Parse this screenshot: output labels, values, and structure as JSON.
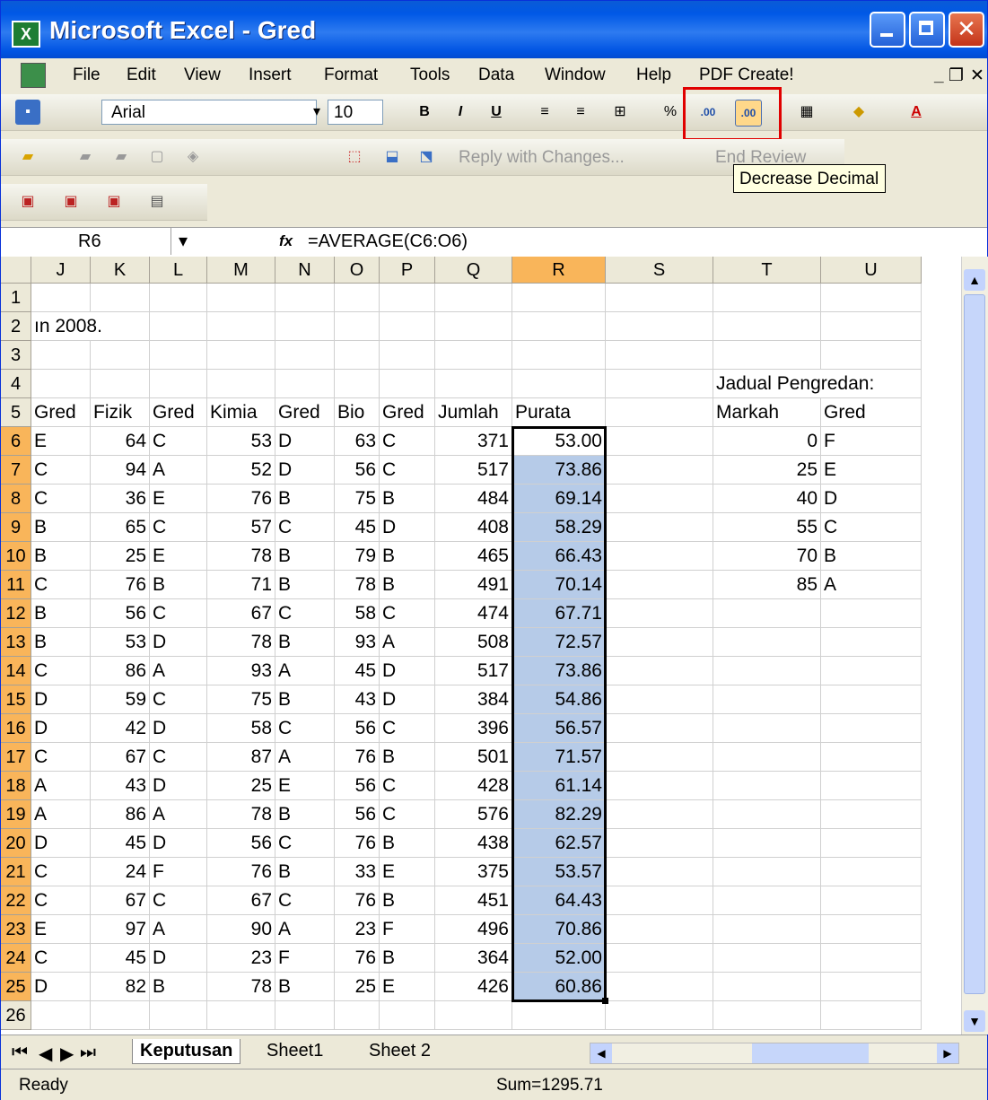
{
  "window": {
    "title": "Microsoft Excel - Gred",
    "icon": "excel-icon"
  },
  "menu": [
    "File",
    "Edit",
    "View",
    "Insert",
    "Format",
    "Tools",
    "Data",
    "Window",
    "Help",
    "PDF Create!"
  ],
  "format_toolbar": {
    "font": "Arial",
    "size": "10",
    "tooltip": "Decrease Decimal",
    "highlight_color": "#e00000"
  },
  "review_toolbar": {
    "reply": "Reply with Changes...",
    "end": "End Review"
  },
  "formula_bar": {
    "name_box": "R6",
    "fx": "fx",
    "formula": "=AVERAGE(C6:O6)"
  },
  "columns": [
    "J",
    "K",
    "L",
    "M",
    "N",
    "O",
    "P",
    "Q",
    "R",
    "S",
    "T",
    "U"
  ],
  "rows": [
    {
      "n": "1",
      "J": "",
      "K": "",
      "L": "",
      "M": "",
      "N": "",
      "O": "",
      "P": "",
      "Q": "",
      "R": "",
      "T": "",
      "U": ""
    },
    {
      "n": "2",
      "J": "ın 2008.",
      "K": "",
      "L": "",
      "M": "",
      "N": "",
      "O": "",
      "P": "",
      "Q": "",
      "R": "",
      "T": "",
      "U": ""
    },
    {
      "n": "3",
      "J": "",
      "K": "",
      "L": "",
      "M": "",
      "N": "",
      "O": "",
      "P": "",
      "Q": "",
      "R": "",
      "T": "",
      "U": ""
    },
    {
      "n": "4",
      "J": "",
      "K": "",
      "L": "",
      "M": "",
      "N": "",
      "O": "",
      "P": "",
      "Q": "",
      "R": "",
      "T": "Jadual Pengredan:",
      "U": ""
    },
    {
      "n": "5",
      "J": "Gred",
      "K": "Fizik",
      "L": "Gred",
      "M": "Kimia",
      "N": "Gred",
      "O": "Bio",
      "P": "Gred",
      "Q": "Jumlah",
      "R": "Purata",
      "T": "Markah",
      "U": "Gred"
    },
    {
      "n": "6",
      "J": "E",
      "K": "64",
      "L": "C",
      "M": "53",
      "N": "D",
      "O": "63",
      "P": "C",
      "Q": "371",
      "R": "53.00",
      "T": "0",
      "U": "F"
    },
    {
      "n": "7",
      "J": "C",
      "K": "94",
      "L": "A",
      "M": "52",
      "N": "D",
      "O": "56",
      "P": "C",
      "Q": "517",
      "R": "73.86",
      "T": "25",
      "U": "E"
    },
    {
      "n": "8",
      "J": "C",
      "K": "36",
      "L": "E",
      "M": "76",
      "N": "B",
      "O": "75",
      "P": "B",
      "Q": "484",
      "R": "69.14",
      "T": "40",
      "U": "D"
    },
    {
      "n": "9",
      "J": "B",
      "K": "65",
      "L": "C",
      "M": "57",
      "N": "C",
      "O": "45",
      "P": "D",
      "Q": "408",
      "R": "58.29",
      "T": "55",
      "U": "C"
    },
    {
      "n": "10",
      "J": "B",
      "K": "25",
      "L": "E",
      "M": "78",
      "N": "B",
      "O": "79",
      "P": "B",
      "Q": "465",
      "R": "66.43",
      "T": "70",
      "U": "B"
    },
    {
      "n": "11",
      "J": "C",
      "K": "76",
      "L": "B",
      "M": "71",
      "N": "B",
      "O": "78",
      "P": "B",
      "Q": "491",
      "R": "70.14",
      "T": "85",
      "U": "A"
    },
    {
      "n": "12",
      "J": "B",
      "K": "56",
      "L": "C",
      "M": "67",
      "N": "C",
      "O": "58",
      "P": "C",
      "Q": "474",
      "R": "67.71",
      "T": "",
      "U": ""
    },
    {
      "n": "13",
      "J": "B",
      "K": "53",
      "L": "D",
      "M": "78",
      "N": "B",
      "O": "93",
      "P": "A",
      "Q": "508",
      "R": "72.57",
      "T": "",
      "U": ""
    },
    {
      "n": "14",
      "J": "C",
      "K": "86",
      "L": "A",
      "M": "93",
      "N": "A",
      "O": "45",
      "P": "D",
      "Q": "517",
      "R": "73.86",
      "T": "",
      "U": ""
    },
    {
      "n": "15",
      "J": "D",
      "K": "59",
      "L": "C",
      "M": "75",
      "N": "B",
      "O": "43",
      "P": "D",
      "Q": "384",
      "R": "54.86",
      "T": "",
      "U": ""
    },
    {
      "n": "16",
      "J": "D",
      "K": "42",
      "L": "D",
      "M": "58",
      "N": "C",
      "O": "56",
      "P": "C",
      "Q": "396",
      "R": "56.57",
      "T": "",
      "U": ""
    },
    {
      "n": "17",
      "J": "C",
      "K": "67",
      "L": "C",
      "M": "87",
      "N": "A",
      "O": "76",
      "P": "B",
      "Q": "501",
      "R": "71.57",
      "T": "",
      "U": ""
    },
    {
      "n": "18",
      "J": "A",
      "K": "43",
      "L": "D",
      "M": "25",
      "N": "E",
      "O": "56",
      "P": "C",
      "Q": "428",
      "R": "61.14",
      "T": "",
      "U": ""
    },
    {
      "n": "19",
      "J": "A",
      "K": "86",
      "L": "A",
      "M": "78",
      "N": "B",
      "O": "56",
      "P": "C",
      "Q": "576",
      "R": "82.29",
      "T": "",
      "U": ""
    },
    {
      "n": "20",
      "J": "D",
      "K": "45",
      "L": "D",
      "M": "56",
      "N": "C",
      "O": "76",
      "P": "B",
      "Q": "438",
      "R": "62.57",
      "T": "",
      "U": ""
    },
    {
      "n": "21",
      "J": "C",
      "K": "24",
      "L": "F",
      "M": "76",
      "N": "B",
      "O": "33",
      "P": "E",
      "Q": "375",
      "R": "53.57",
      "T": "",
      "U": ""
    },
    {
      "n": "22",
      "J": "C",
      "K": "67",
      "L": "C",
      "M": "67",
      "N": "C",
      "O": "76",
      "P": "B",
      "Q": "451",
      "R": "64.43",
      "T": "",
      "U": ""
    },
    {
      "n": "23",
      "J": "E",
      "K": "97",
      "L": "A",
      "M": "90",
      "N": "A",
      "O": "23",
      "P": "F",
      "Q": "496",
      "R": "70.86",
      "T": "",
      "U": ""
    },
    {
      "n": "24",
      "J": "C",
      "K": "45",
      "L": "D",
      "M": "23",
      "N": "F",
      "O": "76",
      "P": "B",
      "Q": "364",
      "R": "52.00",
      "T": "",
      "U": ""
    },
    {
      "n": "25",
      "J": "D",
      "K": "82",
      "L": "B",
      "M": "78",
      "N": "B",
      "O": "25",
      "P": "E",
      "Q": "426",
      "R": "60.86",
      "T": "",
      "U": ""
    },
    {
      "n": "26",
      "J": "",
      "K": "",
      "L": "",
      "M": "",
      "N": "",
      "O": "",
      "P": "",
      "Q": "",
      "R": "",
      "T": "",
      "U": ""
    }
  ],
  "sheet_tabs": [
    "Keputusan",
    "Sheet1",
    "Sheet 2"
  ],
  "status": {
    "left": "Ready",
    "sum": "Sum=1295.71"
  },
  "colors": {
    "title_bar": "#0058e6",
    "selection": "#b6cbe8",
    "header_selected": "#f9b55a",
    "highlight_box": "#e00000"
  }
}
